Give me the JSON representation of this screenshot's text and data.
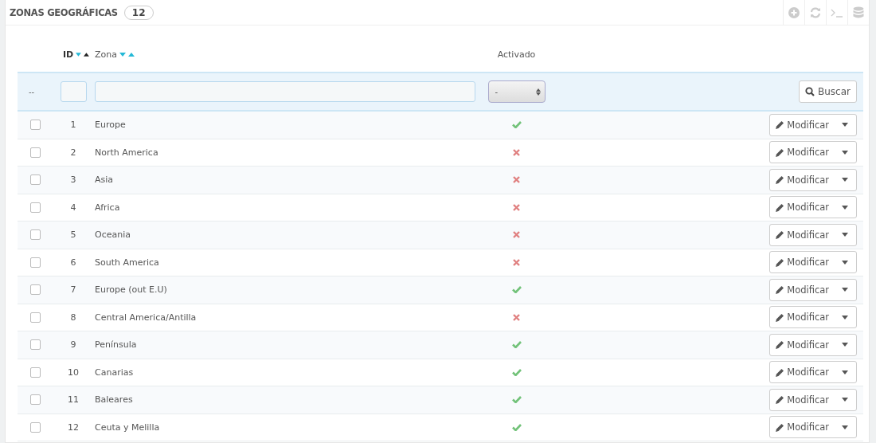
{
  "panel": {
    "title": "ZONAS GEOGRÁFICAS",
    "count": "12"
  },
  "columns": [
    {
      "label": "ID",
      "asc_selected": true,
      "desc_selected": false
    },
    {
      "label": "Zona",
      "asc_selected": false,
      "desc_selected": false
    },
    {
      "label": "Activado"
    }
  ],
  "filters": {
    "bulk": "--",
    "select_value": "-",
    "search_button": "Buscar"
  },
  "rows": [
    {
      "id": "1",
      "zone": "Europe",
      "active": true,
      "checked": false,
      "action": "Modificar"
    },
    {
      "id": "2",
      "zone": "North America",
      "active": false,
      "checked": false,
      "action": "Modificar"
    },
    {
      "id": "3",
      "zone": "Asia",
      "active": false,
      "checked": false,
      "action": "Modificar"
    },
    {
      "id": "4",
      "zone": "Africa",
      "active": false,
      "checked": false,
      "action": "Modificar"
    },
    {
      "id": "5",
      "zone": "Oceania",
      "active": false,
      "checked": false,
      "action": "Modificar"
    },
    {
      "id": "6",
      "zone": "South America",
      "active": false,
      "checked": false,
      "action": "Modificar"
    },
    {
      "id": "7",
      "zone": "Europe (out E.U)",
      "active": true,
      "checked": false,
      "action": "Modificar"
    },
    {
      "id": "8",
      "zone": "Central America/Antilla",
      "active": false,
      "checked": false,
      "action": "Modificar"
    },
    {
      "id": "9",
      "zone": "Península",
      "active": true,
      "checked": false,
      "action": "Modificar"
    },
    {
      "id": "10",
      "zone": "Canarias",
      "active": true,
      "checked": false,
      "action": "Modificar"
    },
    {
      "id": "11",
      "zone": "Baleares",
      "active": true,
      "checked": false,
      "action": "Modificar"
    },
    {
      "id": "12",
      "zone": "Ceuta y Melilla",
      "active": true,
      "checked": false,
      "action": "Modificar"
    }
  ]
}
